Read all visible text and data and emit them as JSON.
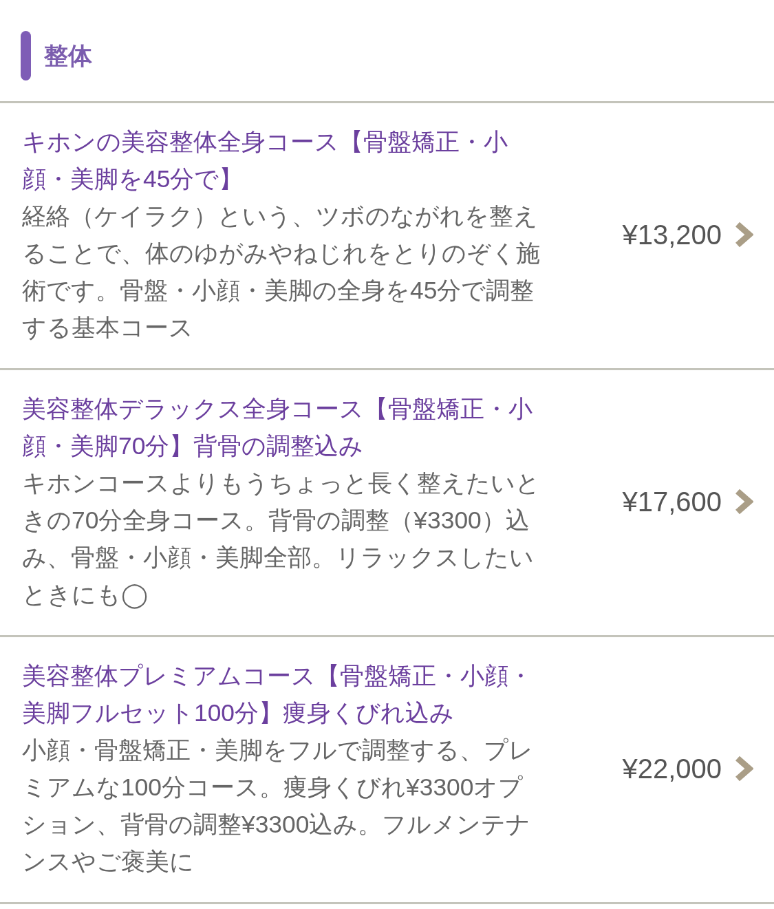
{
  "section": {
    "title": "整体"
  },
  "courses": [
    {
      "title": "キホンの美容整体全身コース【骨盤矯正・小顔・美脚を45分で】",
      "description": "経絡（ケイラク）という、ツボのながれを整えることで、体のゆがみやねじれをとりのぞく施術です。骨盤・小顔・美脚の全身を45分で調整する基本コース",
      "price": "¥13,200"
    },
    {
      "title": "美容整体デラックス全身コース【骨盤矯正・小顔・美脚70分】背骨の調整込み",
      "description": "キホンコースよりもうちょっと長く整えたいときの70分全身コース。背骨の調整（¥3300）込み、骨盤・小顔・美脚全部。リラックスしたいときにも◯",
      "price": "¥17,600"
    },
    {
      "title": "美容整体プレミアムコース【骨盤矯正・小顔・美脚フルセット100分】痩身くびれ込み",
      "description": "小顔・骨盤矯正・美脚をフルで調整する、プレミアムな100分コース。痩身くびれ¥3300オプション、背骨の調整¥3300込み。フルメンテナンスやご褒美に",
      "price": "¥22,000"
    }
  ]
}
